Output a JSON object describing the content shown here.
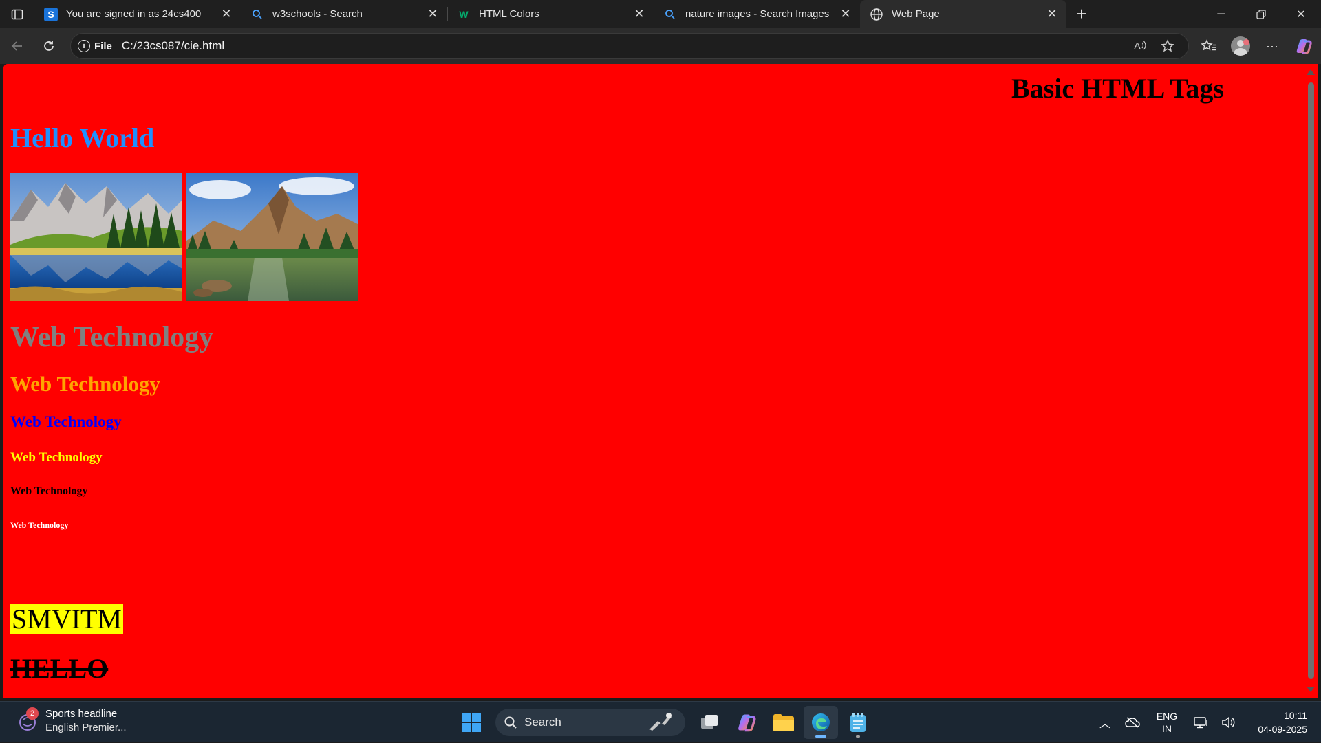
{
  "tabs": [
    {
      "title": "You are signed in as 24cs400",
      "favicon": "s-app-icon",
      "active": false
    },
    {
      "title": "w3schools - Search",
      "favicon": "search-icon",
      "active": false
    },
    {
      "title": "HTML Colors",
      "favicon": "w3schools-icon",
      "active": false
    },
    {
      "title": "nature images - Search Images",
      "favicon": "search-icon",
      "active": false
    },
    {
      "title": "Web Page",
      "favicon": "globe-icon",
      "active": true
    }
  ],
  "addressbar": {
    "scheme_label": "File",
    "url": "C:/23cs087/cie.html"
  },
  "page": {
    "title": "Basic HTML Tags",
    "hello": "Hello World",
    "headings": [
      "Web Technology",
      "Web Technology",
      "Web Technology",
      "Web Technology",
      "Web Technology",
      "Web Technology"
    ],
    "marked_text": "SMVITM",
    "struck_text": "HELLO",
    "background_color": "#ff0000",
    "heading_colors": [
      "#808080",
      "#ffa500",
      "#0000ff",
      "#ffff00",
      "#000000",
      "#ffffff"
    ],
    "hello_color": "#1e90ff"
  },
  "taskbar": {
    "widget": {
      "title": "Sports headline",
      "subtitle": "English Premier...",
      "badge": "2"
    },
    "search_label": "Search",
    "language": {
      "line1": "ENG",
      "line2": "IN"
    },
    "clock": {
      "time": "10:11",
      "date": "04-09-2025"
    }
  }
}
